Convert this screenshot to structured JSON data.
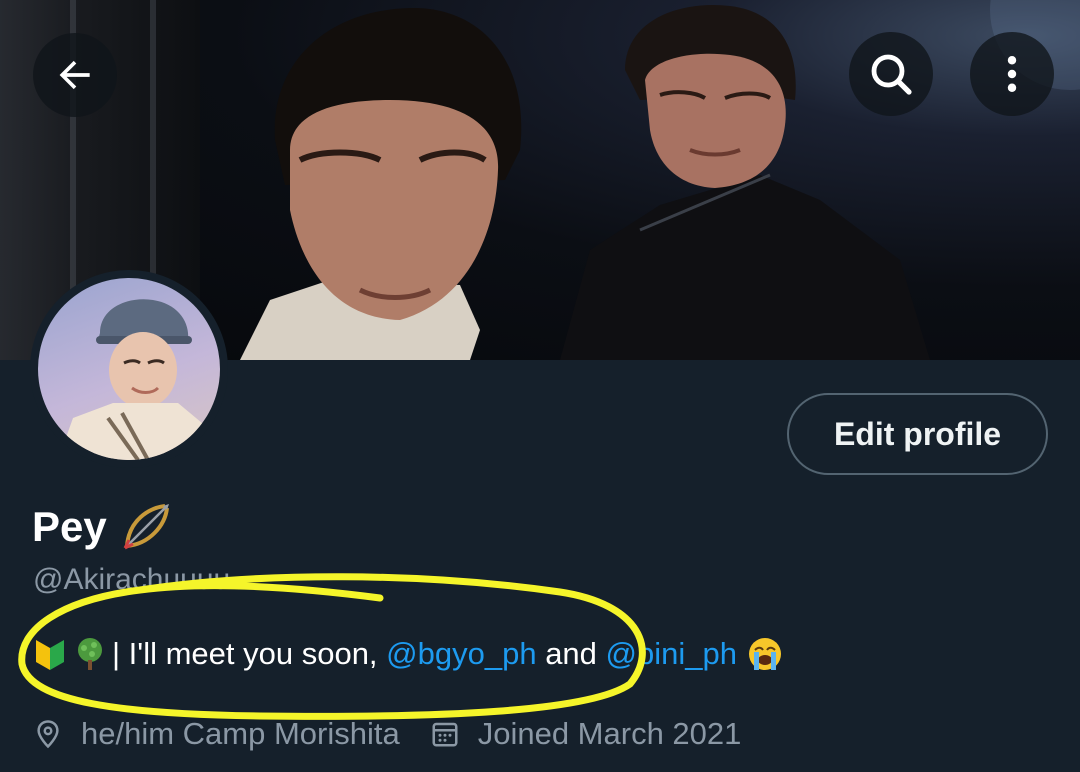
{
  "header": {
    "back_icon": "arrow-left-icon",
    "search_icon": "search-icon",
    "more_icon": "more-vertical-icon"
  },
  "profile": {
    "display_name": "Pey",
    "name_emoji": "bow-and-arrow-emoji",
    "handle": "@Akirachuuuu",
    "edit_label": "Edit profile",
    "bio": {
      "prefix_emojis": [
        "japanese-beginner-symbol-emoji",
        "tree-emoji"
      ],
      "text_before": "| I'll meet you soon, ",
      "mention_1": "@bgyo_ph",
      "text_middle": " and ",
      "mention_2": "@bini_ph",
      "suffix_emoji": "loudly-crying-face-emoji"
    },
    "location": "he/him Camp Morishita",
    "joined": "Joined March 2021"
  },
  "colors": {
    "background": "#15202b",
    "mention": "#1d9bf0",
    "secondary_text": "#8b98a5",
    "highlight_annotation": "#f5f52a"
  }
}
